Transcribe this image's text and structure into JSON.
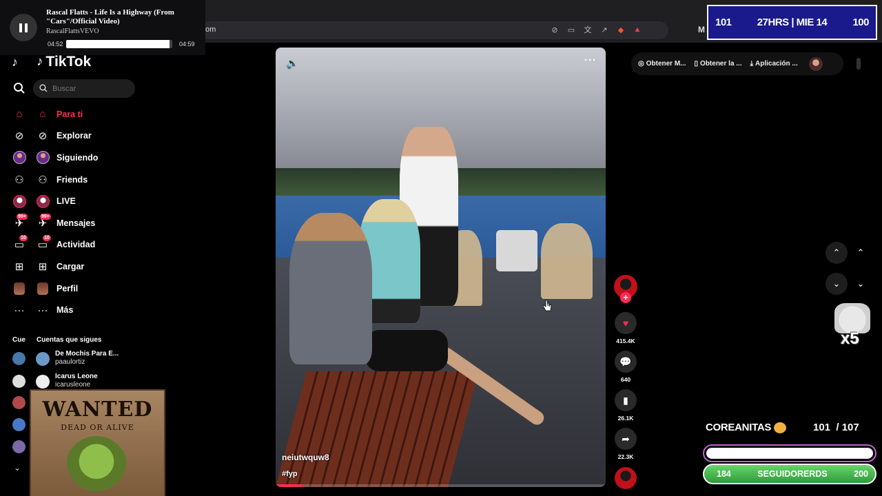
{
  "browser": {
    "address": "om",
    "icons": [
      "mute-tab-icon",
      "cast-icon",
      "translate-icon",
      "share-icon",
      "brave-shield-icon",
      "brave-rewards-icon",
      "extension-m-icon"
    ]
  },
  "music": {
    "title": "Rascal Flatts - Life Is a Highway (From \"Cars\"/Official Video)",
    "artist": "RascalFlattsVEVO",
    "current_time": "04:52",
    "total_time": "04:59",
    "progress_percent": 97.7
  },
  "scorebox": {
    "left": "101",
    "center": "27HRS | MIE 14",
    "right": "100"
  },
  "logo": {
    "text": "TikTok"
  },
  "search": {
    "placeholder": "Buscar"
  },
  "nav": [
    {
      "label": "Para ti",
      "icon": "home-icon",
      "active": true
    },
    {
      "label": "Explorar",
      "icon": "compass-icon"
    },
    {
      "label": "Siguiendo",
      "icon": "following-avatar-icon"
    },
    {
      "label": "Friends",
      "icon": "friends-icon"
    },
    {
      "label": "LIVE",
      "icon": "live-avatar-icon"
    },
    {
      "label": "Mensajes",
      "icon": "messages-icon",
      "badge": "99+"
    },
    {
      "label": "Actividad",
      "icon": "activity-icon",
      "badge": "10"
    },
    {
      "label": "Cargar",
      "icon": "upload-icon"
    },
    {
      "label": "Perfil",
      "icon": "profile-avatar-icon"
    },
    {
      "label": "Más",
      "icon": "more-icon"
    }
  ],
  "following": {
    "heading_short": "Cue",
    "heading": "Cuentas que sigues",
    "accounts": [
      {
        "name": "De Mochis Para E...",
        "handle": "paaulortiz"
      },
      {
        "name": "Icarus Leone",
        "handle": "icarusleone"
      }
    ]
  },
  "wanted": {
    "title": "WANTED",
    "subtitle": "DEAD OR ALIVE"
  },
  "video": {
    "author": "neiutwquw8",
    "caption": "#fyp",
    "progress_percent": 8
  },
  "actions": {
    "likes": "415.4K",
    "comments": "640",
    "saves": "26.1K",
    "shares": "22.3K"
  },
  "pill": {
    "items": [
      "Obtener M...",
      "Obtener la ...",
      "Aplicación ..."
    ]
  },
  "overlay": {
    "x5": "x5",
    "goal_name": "COREANITAS",
    "goal_count": "101  / 107",
    "followers_left": "184",
    "followers_label": "SEGUIDORERDS",
    "followers_right": "200",
    "colors": {
      "accent": "#fe2c55",
      "score_bg": "#1a1a8c",
      "followers_bar": "#2d9c3a"
    }
  }
}
